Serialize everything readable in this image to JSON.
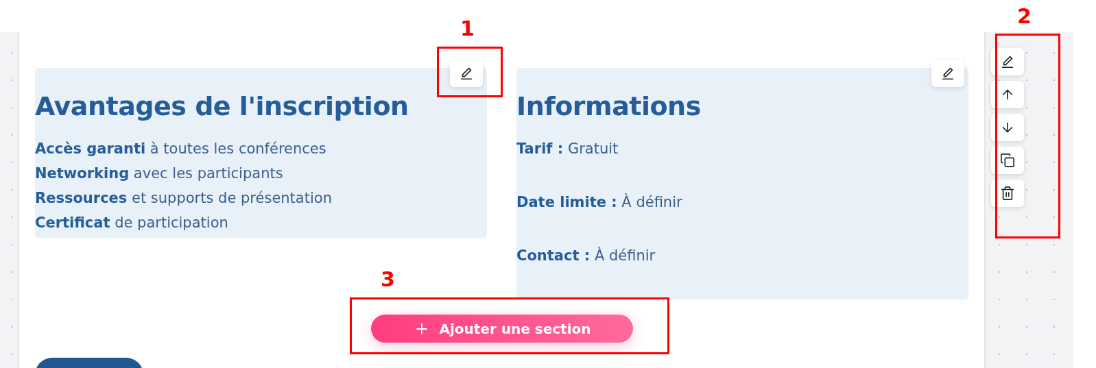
{
  "sections": [
    {
      "kind": "list",
      "title": "Avantages de l'inscription",
      "lines": [
        "**Accès garanti** à toutes les conférences",
        "**Networking** avec les participants",
        "**Ressources** et supports de présentation",
        "**Certificat** de participation"
      ]
    },
    {
      "kind": "fields",
      "title": "Informations",
      "lines": [
        "**Tarif :** Gratuit",
        "**Date limite :** À définir",
        "**Contact :** À définir"
      ]
    }
  ],
  "side_toolbar": {
    "buttons": [
      {
        "kind": "edit"
      },
      {
        "kind": "up"
      },
      {
        "kind": "down"
      },
      {
        "kind": "copy"
      },
      {
        "kind": "delete"
      }
    ]
  },
  "add_section_button": {
    "label": "Ajouter une section"
  },
  "annotations": [
    {
      "number": "1",
      "kind": "card_edit"
    },
    {
      "number": "2",
      "kind": "side_toolbar"
    },
    {
      "number": "3",
      "kind": "add_section"
    }
  ]
}
